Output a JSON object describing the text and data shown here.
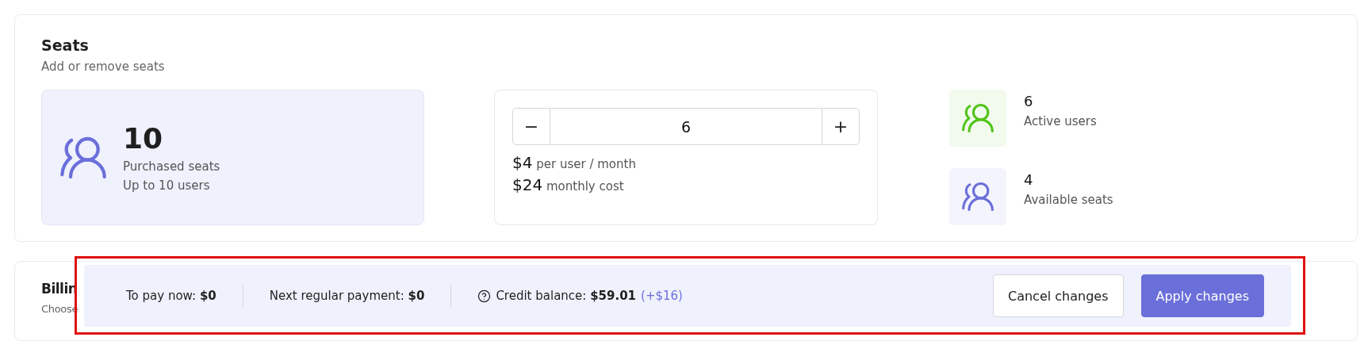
{
  "seats": {
    "title": "Seats",
    "subtitle": "Add or remove seats",
    "purchased": {
      "count": "10",
      "label": "Purchased seats",
      "limit": "Up to 10 users"
    },
    "stepper": {
      "decrement": "−",
      "value": "6",
      "increment": "+"
    },
    "prices": [
      {
        "amount": "$4",
        "label": "per user / month"
      },
      {
        "amount": "$24",
        "label": "monthly cost"
      }
    ],
    "stats": [
      {
        "count": "6",
        "label": "Active users",
        "color": "#52c41a"
      },
      {
        "count": "4",
        "label": "Available seats",
        "color": "#6b6fd9"
      }
    ]
  },
  "billing": {
    "title": "Billin",
    "subtitle": "Choose"
  },
  "summary_bar": {
    "highlighted": true,
    "items": [
      {
        "kind": "plain",
        "text": "To pay now: **$0**"
      },
      {
        "kind": "plain",
        "text": "Next regular payment: **$0**"
      },
      {
        "kind": "help",
        "text": "Credit balance: **$59.01**",
        "change": "(+$16)"
      }
    ],
    "buttons": [
      {
        "label": "Cancel changes",
        "primary": false
      },
      {
        "label": "Apply changes",
        "primary": true
      }
    ]
  }
}
